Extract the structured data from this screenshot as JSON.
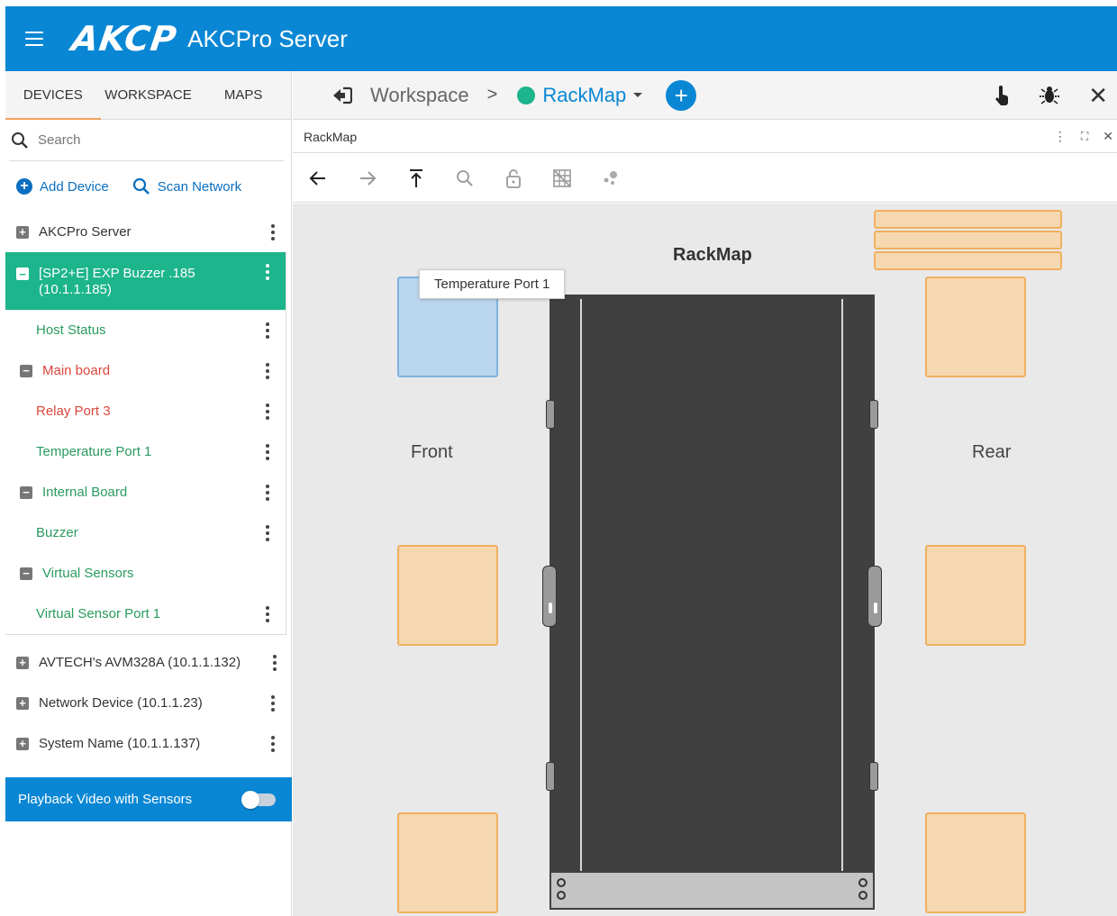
{
  "app": {
    "logo": "AKCP",
    "title": "AKCPro Server"
  },
  "sidebar": {
    "tabs": [
      {
        "label": "DEVICES",
        "active": true
      },
      {
        "label": "WORKSPACE",
        "active": false
      },
      {
        "label": "MAPS",
        "active": false
      }
    ],
    "search": {
      "placeholder": "Search"
    },
    "actions": {
      "add_device": "Add Device",
      "scan_network": "Scan Network"
    },
    "tree": {
      "akcpro_server": "AKCPro Server",
      "expanded_device": "[SP2+E] EXP Buzzer .185\n(10.1.1.185)",
      "children": {
        "host_status": "Host Status",
        "main_board": "Main board",
        "relay_port_3": "Relay Port 3",
        "temperature_port_1": "Temperature Port 1",
        "internal_board": "Internal Board",
        "buzzer": "Buzzer",
        "virtual_sensors": "Virtual Sensors",
        "virtual_sensor_port_1": "Virtual Sensor Port 1"
      },
      "avtech": "AVTECH's AVM328A (10.1.1.132)",
      "network_device": "Network Device (10.1.1.23)",
      "system_name": "System Name (10.1.1.137)"
    },
    "playback": {
      "label": "Playback Video with Sensors",
      "enabled": false
    }
  },
  "header": {
    "breadcrumb_root": "Workspace",
    "breadcrumb_sep": ">",
    "breadcrumb_current": "RackMap",
    "current_status_color": "#1db58b"
  },
  "panel": {
    "title": "RackMap",
    "map_title": "RackMap",
    "tooltip": "Temperature Port 1",
    "front_label": "Front",
    "rear_label": "Rear"
  },
  "colors": {
    "accent": "#0a87d4",
    "selected_green": "#1db58b",
    "ok_text": "#2a9a5e",
    "alarm_text": "#d9463a",
    "sensor_orange": "#f5d8b0",
    "sensor_blue": "#bad6ee"
  }
}
